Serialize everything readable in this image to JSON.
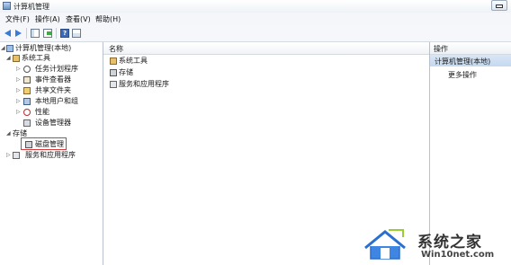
{
  "window": {
    "title": "计算机管理"
  },
  "menu": [
    "文件(F)",
    "操作(A)",
    "查看(V)",
    "帮助(H)"
  ],
  "toolbar": {
    "icons": [
      "back-arrow-icon",
      "forward-arrow-icon",
      "show-tree-icon",
      "export-list-icon",
      "help-icon",
      "properties-icon"
    ]
  },
  "tree": {
    "root": "计算机管理(本地)",
    "system_tools": "系统工具",
    "task_scheduler": "任务计划程序",
    "event_viewer": "事件查看器",
    "shared_folders": "共享文件夹",
    "local_users": "本地用户和组",
    "performance": "性能",
    "device_manager": "设备管理器",
    "storage": "存储",
    "disk_management": "磁盘管理",
    "services_apps": "服务和应用程序"
  },
  "center": {
    "column_name": "名称",
    "items": [
      "系统工具",
      "存储",
      "服务和应用程序"
    ]
  },
  "actions": {
    "header": "操作",
    "section": "计算机管理(本地)",
    "more": "更多操作"
  },
  "watermark": {
    "name": "系统之家",
    "url": "Win10net.com"
  }
}
